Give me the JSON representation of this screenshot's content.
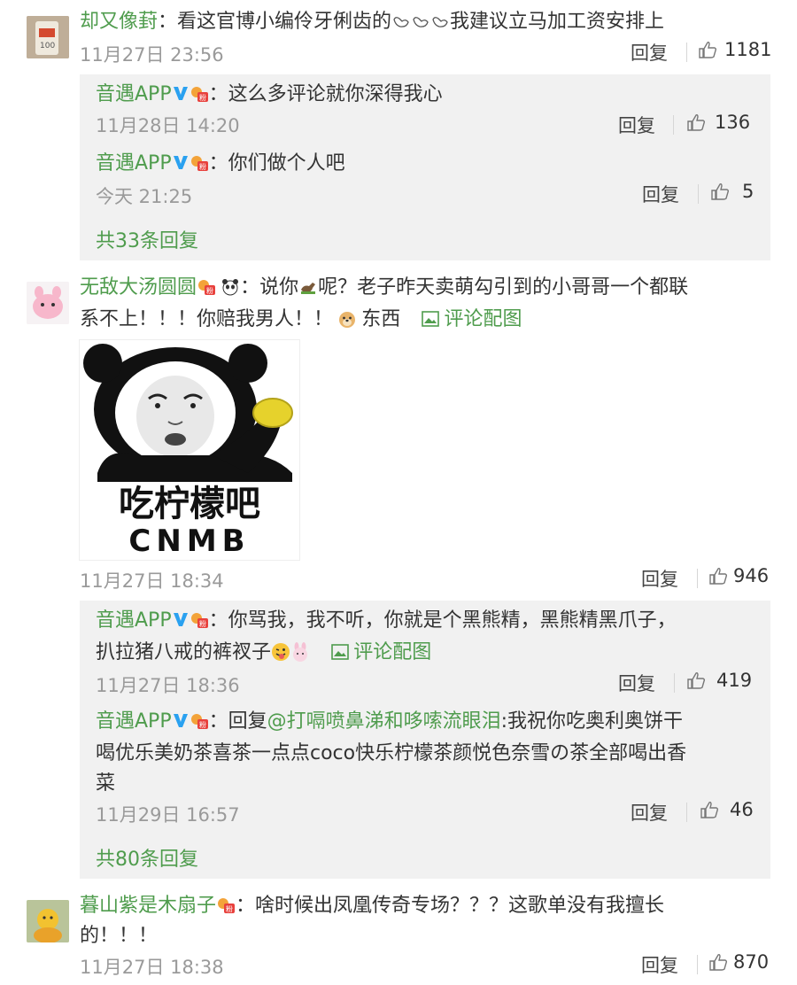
{
  "comments": [
    {
      "user": "却又像葑",
      "text_before": "：看这官博小编伶牙俐齿的",
      "text_after": "我建议立马加工资安排上",
      "time": "11月27日 23:56",
      "reply_label": "回复",
      "likes": "1181",
      "replies": [
        {
          "user": "音遇APP",
          "text": "：这么多评论就你深得我心",
          "time": "11月28日 14:20",
          "reply_label": "回复",
          "likes": "136"
        },
        {
          "user": "音遇APP",
          "text": "：你们做个人吧",
          "time": "今天 21:25",
          "reply_label": "回复",
          "likes": "5"
        }
      ],
      "more": "共33条回复"
    },
    {
      "user": "无敌大汤圆圆",
      "text_a": "：说你",
      "text_b": "呢？老子昨天卖萌勾引到的小哥哥一个都联",
      "text_line2_a": "系不上！！！你赔我男人！！",
      "text_line2_b": "东西",
      "pic_link": "评论配图",
      "image_caption_cn": "吃柠檬吧",
      "image_caption_en": "CNMB",
      "time": "11月27日 18:34",
      "reply_label": "回复",
      "likes": "946",
      "replies": [
        {
          "user": "音遇APP",
          "text_line1": "：你骂我，我不听，你就是个黑熊精，黑熊精黑爪子，",
          "text_line2": "扒拉猪八戒的裤衩子",
          "pic_link": "评论配图",
          "time": "11月27日 18:36",
          "reply_label": "回复",
          "likes": "419"
        },
        {
          "user": "音遇APP",
          "prefix": "：回复",
          "mention": "@打嗝喷鼻涕和哆嗦流眼泪",
          "text_line1": ":我祝你吃奥利奥饼干",
          "text_line2": "喝优乐美奶茶喜茶一点点coco快乐柠檬茶颜悦色奈雪の茶全部喝出香",
          "text_line3": "菜",
          "time": "11月29日 16:57",
          "reply_label": "回复",
          "likes": "46"
        }
      ],
      "more": "共80条回复"
    },
    {
      "user": "暮山紫是木扇子",
      "text_line1": "：啥时候出凤凰传奇专场？？？这歌单没有我擅长",
      "text_line2": "的！！！",
      "time": "11月27日 18:38",
      "reply_label": "回复",
      "likes": "870"
    }
  ],
  "colors": {
    "link_green": "#4f9c4d",
    "meta_gray": "#9a9a9a",
    "reply_bg": "#f1f1f1"
  }
}
